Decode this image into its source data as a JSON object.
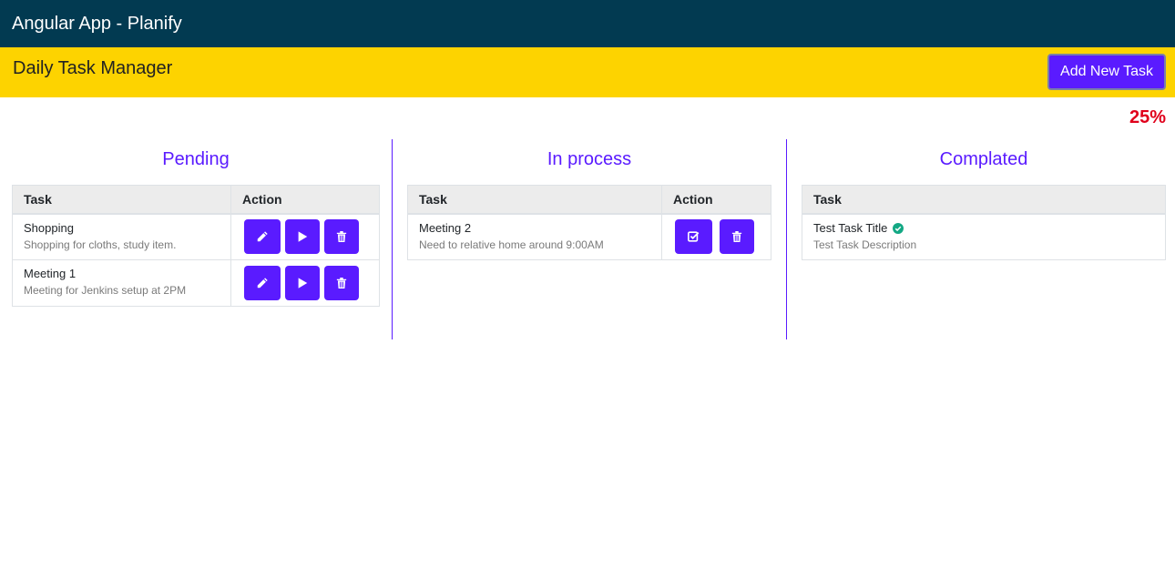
{
  "app": {
    "title": "Angular App - Planify"
  },
  "header": {
    "title": "Daily Task Manager",
    "add_button_label": "Add New Task"
  },
  "progress": {
    "label": "25%",
    "value": 25
  },
  "columns": {
    "pending": {
      "title": "Pending",
      "headers": [
        "Task",
        "Action"
      ],
      "rows": [
        {
          "title": "Shopping",
          "description": "Shopping for cloths, study item."
        },
        {
          "title": "Meeting 1",
          "description": "Meeting for Jenkins setup at 2PM"
        }
      ]
    },
    "in_process": {
      "title": "In process",
      "headers": [
        "Task",
        "Action"
      ],
      "rows": [
        {
          "title": "Meeting 2",
          "description": "Need to relative home around 9:00AM"
        }
      ]
    },
    "completed": {
      "title": "Complated",
      "headers": [
        "Task"
      ],
      "rows": [
        {
          "title": "Test Task Title",
          "description": "Test Task Description"
        }
      ]
    }
  },
  "icons": {
    "edit": "pencil-icon",
    "start": "play-icon",
    "delete": "trash-icon",
    "complete": "check-square-icon",
    "done": "check-circle-icon"
  },
  "colors": {
    "navbar": "#023a51",
    "subheader": "#fdd300",
    "accent": "#5a1bff",
    "progress": "#e0001b",
    "done": "#13a884"
  }
}
